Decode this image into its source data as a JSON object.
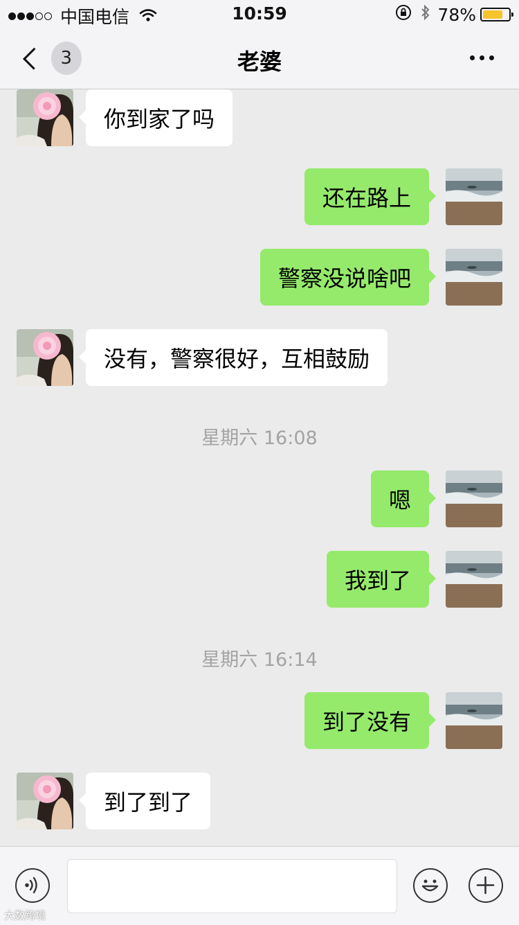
{
  "status_bar": {
    "signal_dots": [
      true,
      true,
      true,
      false,
      false
    ],
    "carrier": "中国电信",
    "time": "10:59",
    "battery_percent": "78%",
    "battery_level": 0.78,
    "icons": [
      "wifi-icon",
      "rotation-lock-icon",
      "bluetooth-icon",
      "battery-icon"
    ]
  },
  "nav": {
    "back_badge": "3",
    "title": "老婆",
    "more_icon": "more-dots-icon"
  },
  "messages": [
    {
      "kind": "msg",
      "side": "left",
      "text": "你到家了吗"
    },
    {
      "kind": "msg",
      "side": "right",
      "text": "还在路上"
    },
    {
      "kind": "msg",
      "side": "right",
      "text": "警察没说啥吧"
    },
    {
      "kind": "msg",
      "side": "left",
      "text": "没有，警察很好，互相鼓励"
    },
    {
      "kind": "time",
      "text": "星期六 16:08"
    },
    {
      "kind": "msg",
      "side": "right",
      "text": "嗯"
    },
    {
      "kind": "msg",
      "side": "right",
      "text": "我到了"
    },
    {
      "kind": "time",
      "text": "星期六 16:14"
    },
    {
      "kind": "msg",
      "side": "right",
      "text": "到了没有"
    },
    {
      "kind": "msg",
      "side": "left",
      "text": "到了到了"
    }
  ],
  "input_bar": {
    "voice_icon": "voice-icon",
    "input_value": "",
    "emoji_icon": "emoji-icon",
    "plus_icon": "plus-icon"
  },
  "watermark": "大数跨境",
  "colors": {
    "chat_background": "#ebebeb",
    "sent_bubble": "#95ea6b",
    "received_bubble": "#ffffff",
    "timestamp_text": "#a3a3a3"
  }
}
